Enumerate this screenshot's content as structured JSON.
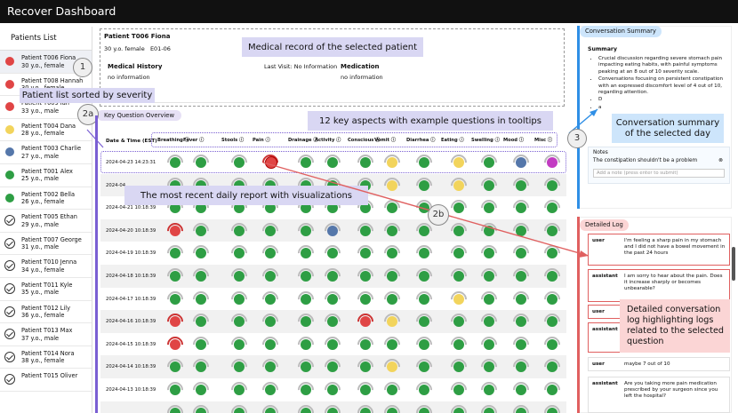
{
  "app_title": "Recover Dashboard",
  "sidebar": {
    "title": "Patients List",
    "patients": [
      {
        "name": "Patient T006 Fiona",
        "info": "30 y.o., female",
        "status": "#e04545"
      },
      {
        "name": "Patient T008 Hannah",
        "info": "30 y.o., female",
        "status": "#e04545"
      },
      {
        "name": "Patient T009 Ian",
        "info": "33 y.o., male",
        "status": "#e04545"
      },
      {
        "name": "Patient T004 Dana",
        "info": "28 y.o., female",
        "status": "#f2d45c"
      },
      {
        "name": "Patient T003 Charlie",
        "info": "27 y.o., male",
        "status": "#5577aa"
      },
      {
        "name": "Patient T001 Alex",
        "info": "25 y.o., male",
        "status": "#2e9e44"
      },
      {
        "name": "Patient T002 Bella",
        "info": "26 y.o., female",
        "status": "#2e9e44"
      },
      {
        "name": "Patient T005 Ethan",
        "info": "29 y.o., male",
        "status": "check"
      },
      {
        "name": "Patient T007 George",
        "info": "31 y.o., male",
        "status": "check"
      },
      {
        "name": "Patient T010 Jenna",
        "info": "34 y.o., female",
        "status": "check"
      },
      {
        "name": "Patient T011 Kyle",
        "info": "35 y.o., male",
        "status": "check"
      },
      {
        "name": "Patient T012 Lily",
        "info": "36 y.o., female",
        "status": "check"
      },
      {
        "name": "Patient T013 Max",
        "info": "37 y.o., male",
        "status": "check"
      },
      {
        "name": "Patient T014 Nora",
        "info": "38 y.o., female",
        "status": "check"
      },
      {
        "name": "Patient T015 Oliver",
        "info": "",
        "status": "check"
      }
    ]
  },
  "record": {
    "name": "Patient T006 Fiona",
    "age_gender": "30 y.o. female",
    "ids": "E01-06",
    "history_label": "Medical History",
    "history_value": "no information",
    "last_visit": "Last Visit: No Information",
    "medication_label": "Medication",
    "medication_value": "no information"
  },
  "callouts": {
    "record": "Medical record of the selected patient",
    "patient_list": "Patient list sorted by severity",
    "key_aspects": "12 key aspects with example questions in tooltips",
    "recent_report": "The most recent daily report with visualizations",
    "summary": "Conversation summary of the selected day",
    "detailed": "Detailed conversation log highlighting logs related to  the selected question"
  },
  "badges": {
    "b1": "1",
    "b2a": "2a",
    "b2b": "2b",
    "b3": "3"
  },
  "overview": {
    "title": "Key Question Overview",
    "date_header": "Date & Time (EST)",
    "aspects": [
      "Breathing ⓘ",
      "Fever ⓘ",
      "Stools ⓘ",
      "Pain ⓘ",
      "Drainage ⓘ",
      "Activity ⓘ",
      "Conscious ⓘ",
      "Vomit ⓘ",
      "Diarrhea ⓘ",
      "Eating ⓘ",
      "Swelling ⓘ",
      "Mood ⓘ",
      "Misc ⓘ"
    ],
    "rows": [
      {
        "date": "2024-04-23 14:23:31",
        "c": [
          "g",
          "g",
          "g",
          "r",
          "g",
          "g",
          "g",
          "y",
          "g",
          "y",
          "g",
          "b",
          "m"
        ]
      },
      {
        "date": "2024-04",
        "c": [
          "g",
          "g",
          "g",
          "g",
          "g",
          "g",
          "g",
          "y",
          "g",
          "y",
          "g",
          "g",
          "g"
        ]
      },
      {
        "date": "2024-04-21 10:18:39",
        "c": [
          "g",
          "g",
          "g",
          "g",
          "g",
          "g",
          "g",
          "g",
          "g",
          "g",
          "g",
          "g",
          "g"
        ]
      },
      {
        "date": "2024-04-20 10:18:39",
        "c": [
          "r",
          "g",
          "g",
          "g",
          "g",
          "b",
          "g",
          "g",
          "g",
          "g",
          "g",
          "g",
          "g"
        ]
      },
      {
        "date": "2024-04-19 10:18:39",
        "c": [
          "g",
          "g",
          "g",
          "g",
          "g",
          "g",
          "g",
          "g",
          "g",
          "g",
          "g",
          "g",
          "g"
        ]
      },
      {
        "date": "2024-04-18 10:18:39",
        "c": [
          "g",
          "g",
          "g",
          "g",
          "g",
          "g",
          "g",
          "g",
          "g",
          "g",
          "g",
          "g",
          "g"
        ]
      },
      {
        "date": "2024-04-17 10:18:39",
        "c": [
          "g",
          "g",
          "g",
          "g",
          "g",
          "g",
          "g",
          "g",
          "g",
          "y",
          "g",
          "g",
          "g"
        ]
      },
      {
        "date": "2024-04-16 10:18:39",
        "c": [
          "r",
          "g",
          "g",
          "g",
          "g",
          "g",
          "r",
          "y",
          "g",
          "g",
          "g",
          "g",
          "g"
        ]
      },
      {
        "date": "2024-04-15 10:18:39",
        "c": [
          "r",
          "g",
          "g",
          "g",
          "g",
          "g",
          "g",
          "g",
          "g",
          "g",
          "g",
          "g",
          "g"
        ]
      },
      {
        "date": "2024-04-14 10:18:39",
        "c": [
          "g",
          "g",
          "g",
          "g",
          "g",
          "g",
          "g",
          "y",
          "g",
          "g",
          "g",
          "g",
          "g"
        ]
      },
      {
        "date": "2024-04-13 10:18:39",
        "c": [
          "g",
          "g",
          "g",
          "g",
          "g",
          "g",
          "g",
          "g",
          "g",
          "g",
          "g",
          "g",
          "g"
        ]
      },
      {
        "date": "",
        "c": [
          "g",
          "g",
          "g",
          "g",
          "g",
          "g",
          "g",
          "g",
          "g",
          "g",
          "g",
          "g",
          "g"
        ]
      }
    ]
  },
  "summary": {
    "tag": "Conversation Summary",
    "title": "Summary",
    "bullets": [
      "Crucial discussion regarding severe stomach pain impacting eating habits, with painful symptoms peaking at an 8 out of 10 severity scale.",
      "Conversations focusing on persistent constipation with an expressed discomfort level of 4 out of 10, regarding attention.",
      "D",
      "a"
    ],
    "notes_label": "Notes",
    "note_text": "The constipation shouldn't be a problem",
    "note_close": "⊗",
    "note_placeholder": "Add a note (press enter to submit)"
  },
  "log": {
    "tag": "Detailed Log",
    "entries": [
      {
        "role": "user",
        "msg": "I'm feeling a sharp pain in my stomach and I did not have a bowel movement in the past 24 hours"
      },
      {
        "role": "assistant",
        "msg": "I am sorry to hear about the pain. Does it increase sharply or becomes unbearable?"
      },
      {
        "role": "user",
        "msg": ""
      },
      {
        "role": "assistant",
        "msg": ""
      },
      {
        "role": "user",
        "msg": "maybe 7 out of 10"
      },
      {
        "role": "assistant",
        "msg": "Are you taking more pain medication prescribed by your surgeon since you left the hospital?"
      }
    ]
  },
  "colors": {
    "g": "#2e9e44",
    "r": "#e04545",
    "y": "#f2d45c",
    "b": "#5577aa",
    "m": "#c23cc2",
    "accent": "#7a5fd3",
    "blue": "#2f8fe6",
    "pink": "#e06060"
  }
}
